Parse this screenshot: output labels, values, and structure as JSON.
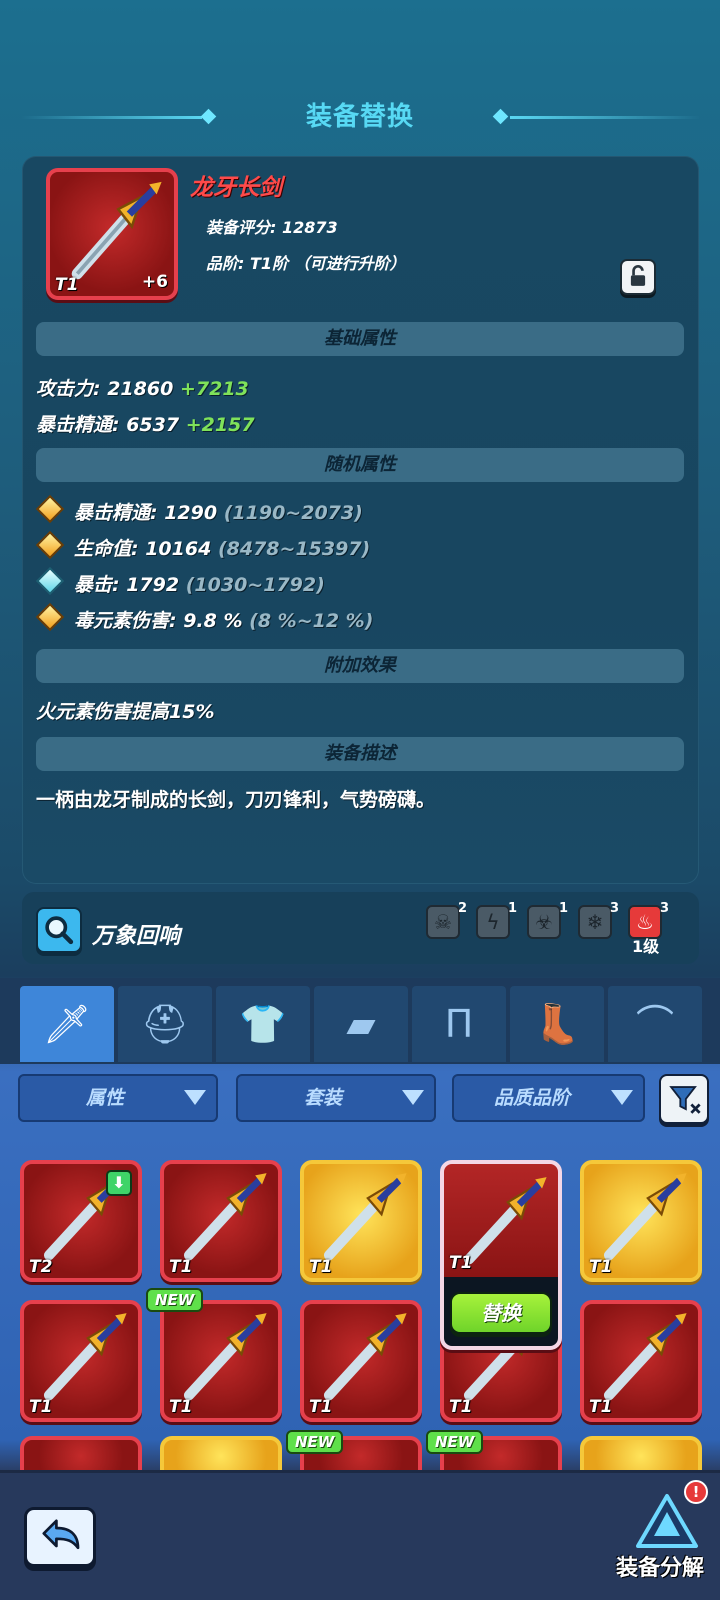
{
  "header": {
    "title": "装备替换"
  },
  "item": {
    "name": "龙牙长剑",
    "score_label": "装备评分: 12873",
    "grade_label": "品阶: T1阶 （可进行升阶）",
    "tier": "T1",
    "plus": "+6",
    "lock_icon": "unlock-icon"
  },
  "sections": {
    "base": "基础属性",
    "random": "随机属性",
    "extra": "附加效果",
    "desc": "装备描述"
  },
  "base_stats": [
    {
      "label": "攻击力: 21860",
      "bonus": "+7213"
    },
    {
      "label": "暴击精通: 6537",
      "bonus": "+2157"
    }
  ],
  "random_stats": [
    {
      "label": "暴击精通: 1290",
      "range": "(1190~2073)",
      "gem": "gold"
    },
    {
      "label": "生命值: 10164",
      "range": "(8478~15397)",
      "gem": "gold"
    },
    {
      "label": "暴击: 1792",
      "range": "(1030~1792)",
      "gem": "cyan"
    },
    {
      "label": "毒元素伤害: 9.8 %",
      "range": "(8 %~12 %)",
      "gem": "gold"
    }
  ],
  "extra_effect": "火元素伤害提高15%",
  "description": "一柄由龙牙制成的长剑，刀刃锋利，气势磅礴。",
  "resonance": {
    "label": "万象回响",
    "icons": [
      {
        "icon": "skull-icon",
        "count": "2"
      },
      {
        "icon": "lightning-icon",
        "count": "1"
      },
      {
        "icon": "poison-icon",
        "count": "1"
      },
      {
        "icon": "ice-icon",
        "count": "3"
      },
      {
        "icon": "fire-icon",
        "count": "3",
        "level": "1级"
      }
    ]
  },
  "tabs": [
    "weapon-icon",
    "helmet-icon",
    "armor-icon",
    "bracer-icon",
    "pants-icon",
    "boots-icon",
    "cape-icon"
  ],
  "filters": {
    "attr": "属性",
    "set": "套装",
    "quality": "品质品阶"
  },
  "grid": [
    {
      "tier": "T2",
      "rarity": "red",
      "upgrade": true
    },
    {
      "tier": "T1",
      "rarity": "red"
    },
    {
      "tier": "T1",
      "rarity": "gold"
    },
    {
      "tier": "T1",
      "rarity": "red",
      "selected": true
    },
    {
      "tier": "T1",
      "rarity": "gold"
    },
    {
      "tier": "T1",
      "rarity": "red"
    },
    {
      "tier": "T1",
      "rarity": "red",
      "new": true
    },
    {
      "tier": "T1",
      "rarity": "red"
    },
    {
      "tier": "T1",
      "rarity": "red"
    },
    {
      "tier": "T1",
      "rarity": "red"
    }
  ],
  "replace_label": "替换",
  "new_label": "NEW",
  "bottom": {
    "decompose_label": "装备分解",
    "alert": "!"
  },
  "colors": {
    "accent": "#57d9f4",
    "bonus_green": "#7fe25a",
    "red_frame": "#e6404d",
    "gold_frame": "#f5c83a"
  }
}
